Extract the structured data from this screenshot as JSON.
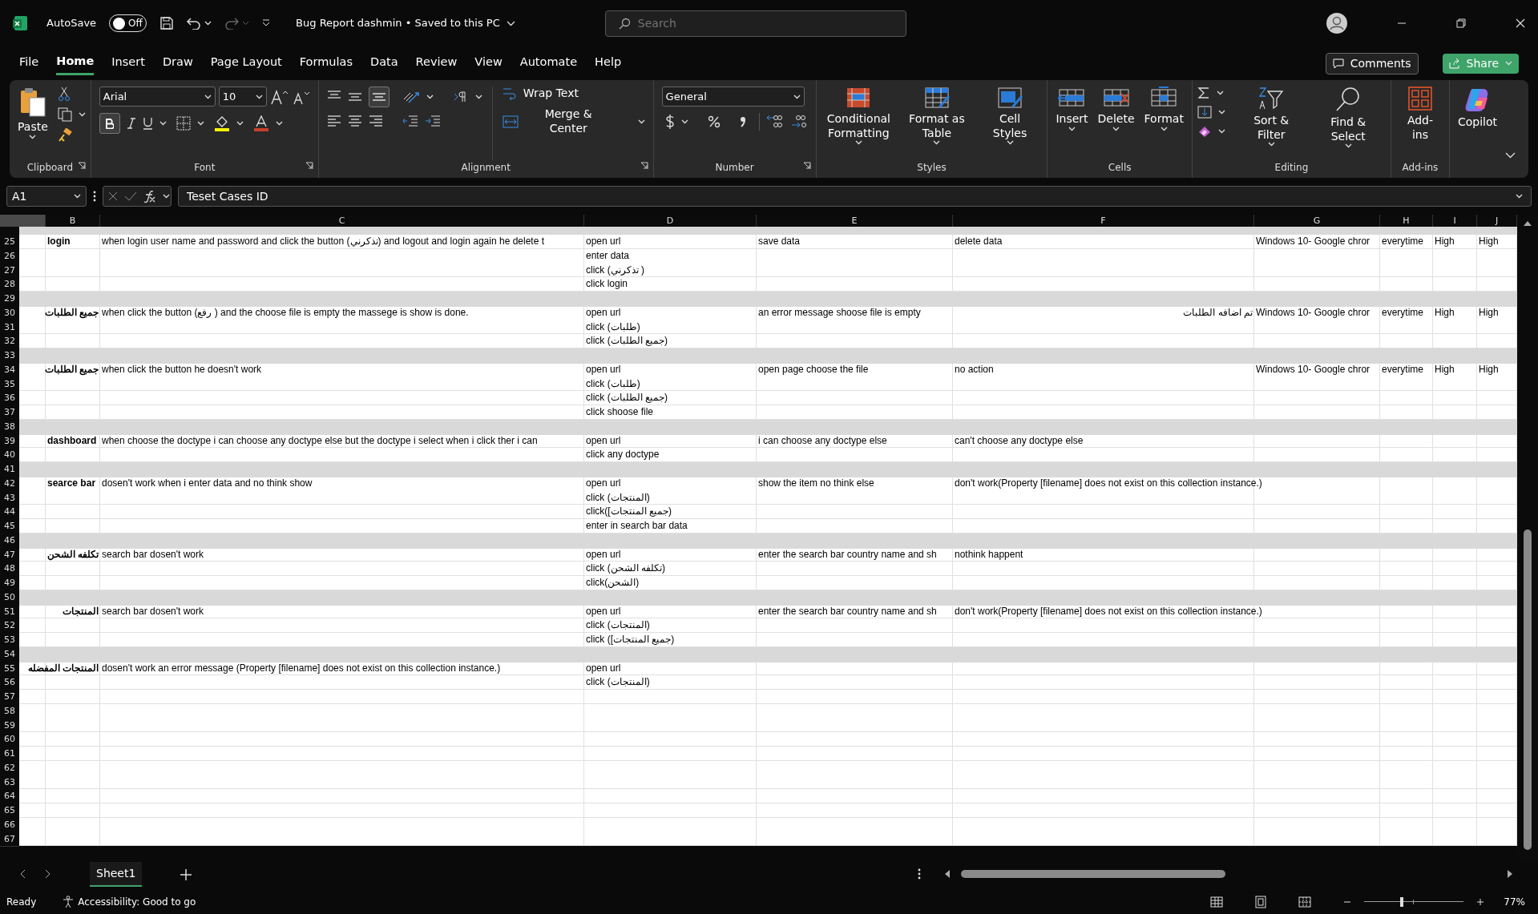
{
  "title_bar": {
    "autosave_label": "AutoSave",
    "autosave": {
      "on": false,
      "label": "Off"
    },
    "document_title": "Bug Report dashmin • Saved to this PC",
    "search_placeholder": "Search"
  },
  "menu_tabs": [
    {
      "label": "File",
      "selected": false
    },
    {
      "label": "Home",
      "selected": true
    },
    {
      "label": "Insert",
      "selected": false
    },
    {
      "label": "Draw",
      "selected": false
    },
    {
      "label": "Page Layout",
      "selected": false
    },
    {
      "label": "Formulas",
      "selected": false
    },
    {
      "label": "Data",
      "selected": false
    },
    {
      "label": "Review",
      "selected": false
    },
    {
      "label": "View",
      "selected": false
    },
    {
      "label": "Automate",
      "selected": false
    },
    {
      "label": "Help",
      "selected": false
    }
  ],
  "header_buttons": {
    "comments": "Comments",
    "share": "Share"
  },
  "ribbon": [
    {
      "kind": "clipboard",
      "label": "Clipboard",
      "paste": "Paste"
    },
    {
      "kind": "font",
      "label": "Font",
      "font_name": "Arial",
      "font_size": "10",
      "bold": true
    },
    {
      "kind": "alignment",
      "label": "Alignment",
      "wrap_text": "Wrap Text",
      "merge": "Merge & Center",
      "bottom_align": true
    },
    {
      "kind": "number",
      "label": "Number",
      "format": "General"
    },
    {
      "kind": "styles",
      "label": "Styles",
      "buttons": [
        "Conditional Formatting",
        "Format as Table",
        "Cell Styles"
      ]
    },
    {
      "kind": "cells",
      "label": "Cells",
      "buttons": [
        "Insert",
        "Delete",
        "Format"
      ]
    },
    {
      "kind": "editing",
      "label": "Editing",
      "buttons": [
        "Sort & Filter",
        "Find & Select"
      ]
    },
    {
      "kind": "addins",
      "label": "Add-ins",
      "buttons": [
        "Add-ins"
      ]
    },
    {
      "kind": "copilot",
      "buttons": [
        "Copilot"
      ]
    }
  ],
  "formula_bar": {
    "name_box": "A1",
    "formula": "Teset Cases ID"
  },
  "columns": [
    {
      "selected": true
    },
    {
      "letter": "B",
      "selected": false
    },
    {
      "letter": "C",
      "selected": false
    },
    {
      "letter": "D",
      "selected": false
    },
    {
      "letter": "E",
      "selected": false
    },
    {
      "letter": "F",
      "selected": false
    },
    {
      "letter": "G",
      "selected": false
    },
    {
      "letter": "H",
      "selected": false
    },
    {
      "letter": "I",
      "selected": false
    },
    {
      "letter": "J",
      "selected": false
    }
  ],
  "rows": [
    {
      "n": "25",
      "kind": "data",
      "cells": {
        "col_b": "login",
        "col_c": "when  login user name and password  and click the button (تذكرني)  and logout and login again he delete t",
        "col_d": "open url",
        "col_e": "save data",
        "col_f": "delete data",
        "col_g": "Windows 10- Google chror",
        "col_h": "everytime",
        "col_i": "High",
        "col_j": "High"
      }
    },
    {
      "n": "26",
      "kind": "data",
      "cells": {
        "col_d": "enter data"
      }
    },
    {
      "n": "27",
      "kind": "data",
      "cells": {
        "col_d": "click (تذكرني )"
      }
    },
    {
      "n": "28",
      "kind": "data",
      "cells": {
        "col_d": "click login"
      }
    },
    {
      "n": "29",
      "kind": "separator"
    },
    {
      "n": "30",
      "kind": "data",
      "cells": {
        "col_b": "جميع الطلبات",
        "col_c": "when click the button (رفع ) and the choose file is empty  the massege is show is done.",
        "col_d": "open url",
        "col_e": "an error message shoose file is empty",
        "col_f": "تم اضافه الطلبات",
        "col_g": "Windows 10- Google chror",
        "col_h": "everytime",
        "col_i": "High",
        "col_j": "High"
      }
    },
    {
      "n": "31",
      "kind": "data",
      "cells": {
        "col_d": "click (طلبات)"
      }
    },
    {
      "n": "32",
      "kind": "data",
      "cells": {
        "col_d": "click (جميع الطلبات)"
      }
    },
    {
      "n": "33",
      "kind": "separator"
    },
    {
      "n": "34",
      "kind": "data",
      "cells": {
        "col_b": "جميع الطلبات",
        "col_c": "when click the button he doesn't work",
        "col_d": "open url",
        "col_e": "open page choose the file",
        "col_f": "no action",
        "col_g": "Windows 10- Google chror",
        "col_h": "everytime",
        "col_i": "High",
        "col_j": "High"
      }
    },
    {
      "n": "35",
      "kind": "data",
      "cells": {
        "col_d": "click (طلبات)"
      }
    },
    {
      "n": "36",
      "kind": "data",
      "cells": {
        "col_d": "click (جميع الطلبات)"
      }
    },
    {
      "n": "37",
      "kind": "data",
      "cells": {
        "col_d": "click shoose file"
      }
    },
    {
      "n": "38",
      "kind": "separator"
    },
    {
      "n": "39",
      "kind": "data",
      "cells": {
        "col_b": "dashboard",
        "col_c": "when choose the doctype i can choose any doctype else but the doctype i select when i click ther i can",
        "col_d": "open url",
        "col_e": "i can choose any doctype else",
        "col_f": "can't choose any doctype else"
      }
    },
    {
      "n": "40",
      "kind": "data",
      "cells": {
        "col_d": "click any doctype"
      }
    },
    {
      "n": "41",
      "kind": "separator"
    },
    {
      "n": "42",
      "kind": "data",
      "cells": {
        "col_b": "searce bar",
        "col_c": "dosen't work when i enter data and no think show",
        "col_d": "open url",
        "col_e": "show the item no think else",
        "col_f": "don't work(Property [filename] does not exist on this collection instance.)"
      }
    },
    {
      "n": "43",
      "kind": "data",
      "cells": {
        "col_d": "click (المنتجات)"
      }
    },
    {
      "n": "44",
      "kind": "data",
      "cells": {
        "col_d": "click([جميع المنتجات)"
      }
    },
    {
      "n": "45",
      "kind": "data",
      "cells": {
        "col_d": "enter in search bar data"
      }
    },
    {
      "n": "46",
      "kind": "separator"
    },
    {
      "n": "47",
      "kind": "data",
      "cells": {
        "col_b": "تكلفه الشحن",
        "col_c": "search bar dosen't work",
        "col_d": "open url",
        "col_e": "enter the search bar country name and sh",
        "col_f": "nothink happent"
      }
    },
    {
      "n": "48",
      "kind": "data",
      "cells": {
        "col_d": "click (تكلفه الشحن)"
      }
    },
    {
      "n": "49",
      "kind": "data",
      "cells": {
        "col_d": "click(الشحن)"
      }
    },
    {
      "n": "50",
      "kind": "separator"
    },
    {
      "n": "51",
      "kind": "data",
      "cells": {
        "col_b": "المنتجات",
        "col_c": "search bar dosen't work",
        "col_d": "open url",
        "col_e": "enter the search bar country name and sh",
        "col_f": "don't work(Property [filename] does not exist on this collection instance.)"
      }
    },
    {
      "n": "52",
      "kind": "data",
      "cells": {
        "col_d": "click (المنتجات)"
      }
    },
    {
      "n": "53",
      "kind": "data",
      "cells": {
        "col_d": "click ([جميع المنتجات)"
      }
    },
    {
      "n": "54",
      "kind": "separator"
    },
    {
      "n": "55",
      "kind": "data",
      "cells": {
        "col_b": "المنتجات المفضله",
        "col_c": "dosen't work an error message (Property [filename] does not exist on this collection instance.)",
        "col_d": "open url"
      }
    },
    {
      "n": "56",
      "kind": "data",
      "cells": {
        "col_d": "click (المنتجات)"
      }
    },
    {
      "n": "57",
      "kind": "data"
    },
    {
      "n": "58",
      "kind": "data"
    },
    {
      "n": "59",
      "kind": "data"
    },
    {
      "n": "60",
      "kind": "data"
    },
    {
      "n": "61",
      "kind": "data"
    },
    {
      "n": "62",
      "kind": "data"
    },
    {
      "n": "63",
      "kind": "data"
    },
    {
      "n": "64",
      "kind": "data"
    },
    {
      "n": "65",
      "kind": "data"
    },
    {
      "n": "66",
      "kind": "data"
    },
    {
      "n": "67",
      "kind": "data"
    }
  ],
  "sheet_tabs": [
    {
      "label": "Sheet1",
      "selected": true
    }
  ],
  "status_bar": {
    "status": "Ready",
    "accessibility": "Accessibility: Good to go",
    "zoom": {
      "level": 0.38,
      "reading": "77%"
    }
  }
}
